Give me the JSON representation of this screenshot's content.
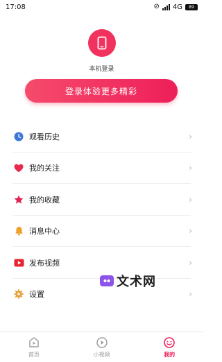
{
  "status_bar": {
    "time": "17:08",
    "network": "4G",
    "battery": "89"
  },
  "login": {
    "local_login_label": "本机登录",
    "button_label": "登录体验更多精彩"
  },
  "menu": {
    "items": [
      {
        "label": "观看历史",
        "icon": "clock-icon"
      },
      {
        "label": "我的关注",
        "icon": "heart-icon"
      },
      {
        "label": "我的收藏",
        "icon": "star-icon"
      },
      {
        "label": "消息中心",
        "icon": "bell-icon"
      },
      {
        "label": "发布视频",
        "icon": "play-icon"
      },
      {
        "label": "设置",
        "icon": "gear-icon"
      }
    ]
  },
  "watermark": {
    "text": "文术网"
  },
  "tabbar": {
    "tabs": [
      {
        "label": "首页",
        "icon": "home-play-icon",
        "active": false
      },
      {
        "label": "小视频",
        "icon": "video-play-icon",
        "active": false
      },
      {
        "label": "我的",
        "icon": "smile-icon",
        "active": true
      }
    ]
  },
  "colors": {
    "accent": "#ee1f5a",
    "clock": "#3f78d8",
    "heart": "#e62a4f",
    "star": "#e0224c",
    "bell": "#f0a02a",
    "play": "#e8242e",
    "gear": "#e8a03a"
  }
}
